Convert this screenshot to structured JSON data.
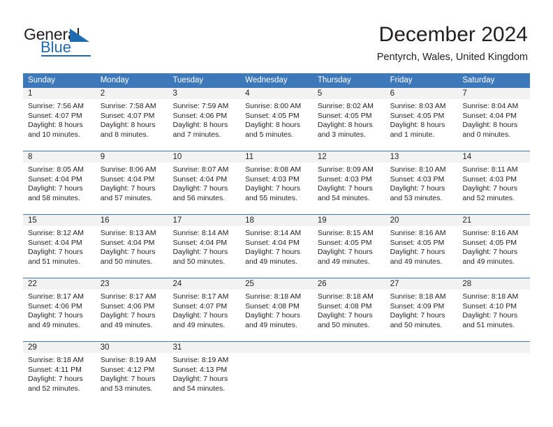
{
  "logo": {
    "word_top": "General",
    "word_bottom": "Blue",
    "triangle_icon": "triangle-icon",
    "accent_color": "#1f6bb0"
  },
  "header": {
    "title": "December 2024",
    "subtitle": "Pentyrch, Wales, United Kingdom"
  },
  "calendar": {
    "header_bg": "#3d79ba",
    "daynum_bg": "#f2f2f2",
    "weekdays": [
      "Sunday",
      "Monday",
      "Tuesday",
      "Wednesday",
      "Thursday",
      "Friday",
      "Saturday"
    ],
    "weeks": [
      [
        {
          "day": "1",
          "lines": [
            "Sunrise: 7:56 AM",
            "Sunset: 4:07 PM",
            "Daylight: 8 hours",
            "and 10 minutes."
          ]
        },
        {
          "day": "2",
          "lines": [
            "Sunrise: 7:58 AM",
            "Sunset: 4:07 PM",
            "Daylight: 8 hours",
            "and 8 minutes."
          ]
        },
        {
          "day": "3",
          "lines": [
            "Sunrise: 7:59 AM",
            "Sunset: 4:06 PM",
            "Daylight: 8 hours",
            "and 7 minutes."
          ]
        },
        {
          "day": "4",
          "lines": [
            "Sunrise: 8:00 AM",
            "Sunset: 4:05 PM",
            "Daylight: 8 hours",
            "and 5 minutes."
          ]
        },
        {
          "day": "5",
          "lines": [
            "Sunrise: 8:02 AM",
            "Sunset: 4:05 PM",
            "Daylight: 8 hours",
            "and 3 minutes."
          ]
        },
        {
          "day": "6",
          "lines": [
            "Sunrise: 8:03 AM",
            "Sunset: 4:05 PM",
            "Daylight: 8 hours",
            "and 1 minute."
          ]
        },
        {
          "day": "7",
          "lines": [
            "Sunrise: 8:04 AM",
            "Sunset: 4:04 PM",
            "Daylight: 8 hours",
            "and 0 minutes."
          ]
        }
      ],
      [
        {
          "day": "8",
          "lines": [
            "Sunrise: 8:05 AM",
            "Sunset: 4:04 PM",
            "Daylight: 7 hours",
            "and 58 minutes."
          ]
        },
        {
          "day": "9",
          "lines": [
            "Sunrise: 8:06 AM",
            "Sunset: 4:04 PM",
            "Daylight: 7 hours",
            "and 57 minutes."
          ]
        },
        {
          "day": "10",
          "lines": [
            "Sunrise: 8:07 AM",
            "Sunset: 4:04 PM",
            "Daylight: 7 hours",
            "and 56 minutes."
          ]
        },
        {
          "day": "11",
          "lines": [
            "Sunrise: 8:08 AM",
            "Sunset: 4:03 PM",
            "Daylight: 7 hours",
            "and 55 minutes."
          ]
        },
        {
          "day": "12",
          "lines": [
            "Sunrise: 8:09 AM",
            "Sunset: 4:03 PM",
            "Daylight: 7 hours",
            "and 54 minutes."
          ]
        },
        {
          "day": "13",
          "lines": [
            "Sunrise: 8:10 AM",
            "Sunset: 4:03 PM",
            "Daylight: 7 hours",
            "and 53 minutes."
          ]
        },
        {
          "day": "14",
          "lines": [
            "Sunrise: 8:11 AM",
            "Sunset: 4:03 PM",
            "Daylight: 7 hours",
            "and 52 minutes."
          ]
        }
      ],
      [
        {
          "day": "15",
          "lines": [
            "Sunrise: 8:12 AM",
            "Sunset: 4:04 PM",
            "Daylight: 7 hours",
            "and 51 minutes."
          ]
        },
        {
          "day": "16",
          "lines": [
            "Sunrise: 8:13 AM",
            "Sunset: 4:04 PM",
            "Daylight: 7 hours",
            "and 50 minutes."
          ]
        },
        {
          "day": "17",
          "lines": [
            "Sunrise: 8:14 AM",
            "Sunset: 4:04 PM",
            "Daylight: 7 hours",
            "and 50 minutes."
          ]
        },
        {
          "day": "18",
          "lines": [
            "Sunrise: 8:14 AM",
            "Sunset: 4:04 PM",
            "Daylight: 7 hours",
            "and 49 minutes."
          ]
        },
        {
          "day": "19",
          "lines": [
            "Sunrise: 8:15 AM",
            "Sunset: 4:05 PM",
            "Daylight: 7 hours",
            "and 49 minutes."
          ]
        },
        {
          "day": "20",
          "lines": [
            "Sunrise: 8:16 AM",
            "Sunset: 4:05 PM",
            "Daylight: 7 hours",
            "and 49 minutes."
          ]
        },
        {
          "day": "21",
          "lines": [
            "Sunrise: 8:16 AM",
            "Sunset: 4:05 PM",
            "Daylight: 7 hours",
            "and 49 minutes."
          ]
        }
      ],
      [
        {
          "day": "22",
          "lines": [
            "Sunrise: 8:17 AM",
            "Sunset: 4:06 PM",
            "Daylight: 7 hours",
            "and 49 minutes."
          ]
        },
        {
          "day": "23",
          "lines": [
            "Sunrise: 8:17 AM",
            "Sunset: 4:06 PM",
            "Daylight: 7 hours",
            "and 49 minutes."
          ]
        },
        {
          "day": "24",
          "lines": [
            "Sunrise: 8:17 AM",
            "Sunset: 4:07 PM",
            "Daylight: 7 hours",
            "and 49 minutes."
          ]
        },
        {
          "day": "25",
          "lines": [
            "Sunrise: 8:18 AM",
            "Sunset: 4:08 PM",
            "Daylight: 7 hours",
            "and 49 minutes."
          ]
        },
        {
          "day": "26",
          "lines": [
            "Sunrise: 8:18 AM",
            "Sunset: 4:08 PM",
            "Daylight: 7 hours",
            "and 50 minutes."
          ]
        },
        {
          "day": "27",
          "lines": [
            "Sunrise: 8:18 AM",
            "Sunset: 4:09 PM",
            "Daylight: 7 hours",
            "and 50 minutes."
          ]
        },
        {
          "day": "28",
          "lines": [
            "Sunrise: 8:18 AM",
            "Sunset: 4:10 PM",
            "Daylight: 7 hours",
            "and 51 minutes."
          ]
        }
      ],
      [
        {
          "day": "29",
          "lines": [
            "Sunrise: 8:18 AM",
            "Sunset: 4:11 PM",
            "Daylight: 7 hours",
            "and 52 minutes."
          ]
        },
        {
          "day": "30",
          "lines": [
            "Sunrise: 8:19 AM",
            "Sunset: 4:12 PM",
            "Daylight: 7 hours",
            "and 53 minutes."
          ]
        },
        {
          "day": "31",
          "lines": [
            "Sunrise: 8:19 AM",
            "Sunset: 4:13 PM",
            "Daylight: 7 hours",
            "and 54 minutes."
          ]
        },
        {
          "day": "",
          "lines": []
        },
        {
          "day": "",
          "lines": []
        },
        {
          "day": "",
          "lines": []
        },
        {
          "day": "",
          "lines": []
        }
      ]
    ]
  }
}
